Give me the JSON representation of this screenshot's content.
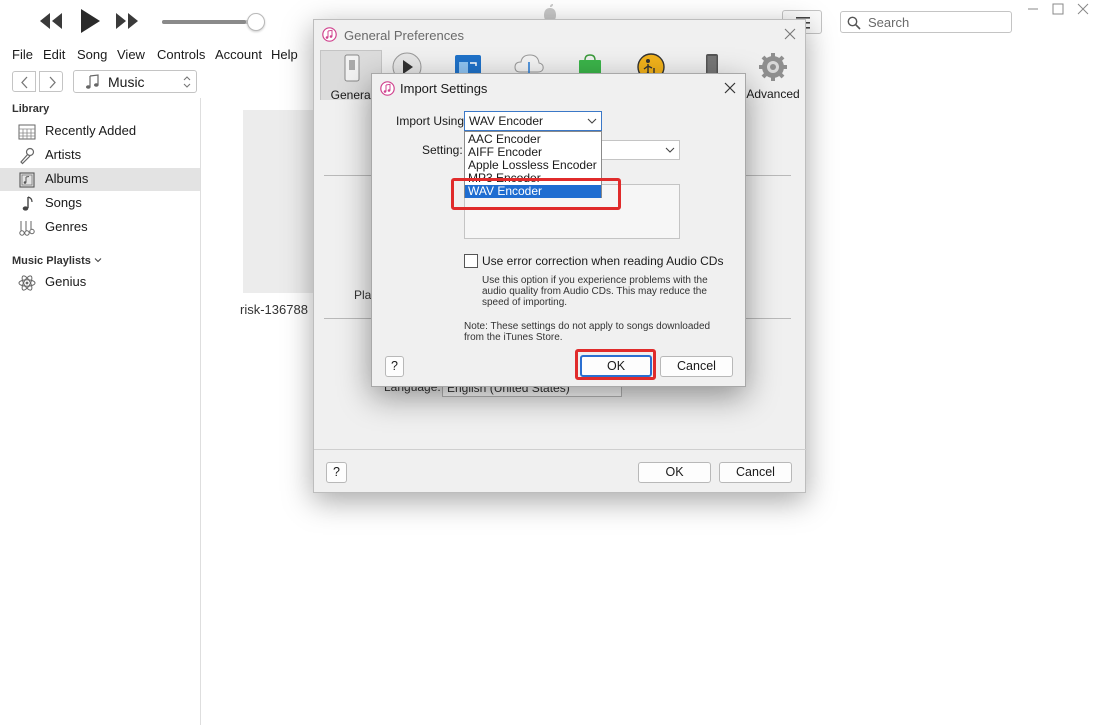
{
  "player": {
    "volume_fraction": 0.88
  },
  "search": {
    "placeholder": "Search"
  },
  "menu": [
    "File",
    "Edit",
    "Song",
    "View",
    "Controls",
    "Account",
    "Help"
  ],
  "media_select": {
    "value": "Music"
  },
  "sidebar": {
    "library_heading": "Library",
    "items": [
      {
        "label": "Recently Added",
        "icon": "calendar-grid-icon"
      },
      {
        "label": "Artists",
        "icon": "microphone-icon"
      },
      {
        "label": "Albums",
        "icon": "album-icon",
        "selected": true
      },
      {
        "label": "Songs",
        "icon": "music-note-icon"
      },
      {
        "label": "Genres",
        "icon": "genres-icon"
      }
    ],
    "playlists_heading": "Music Playlists",
    "playlists": [
      {
        "label": "Genius",
        "icon": "atom-icon"
      }
    ]
  },
  "main": {
    "album_title": "risk-136788"
  },
  "prefs": {
    "title": "General Preferences",
    "tabs": [
      {
        "label": "General",
        "icon": "switch-icon",
        "selected": true
      },
      {
        "label": "",
        "icon": "play-circle-icon"
      },
      {
        "label": "",
        "icon": "media-folder-icon"
      },
      {
        "label": "",
        "icon": "cloud-download-icon"
      },
      {
        "label": "",
        "icon": "store-bag-icon"
      },
      {
        "label": "",
        "icon": "parental-icon"
      },
      {
        "label": "",
        "icon": "device-icon"
      },
      {
        "label": "Advanced",
        "icon": "gear-icon"
      }
    ],
    "playback_fragment": "Play",
    "language_label_fragment": "Language:",
    "language_value": "English (United States)",
    "help_label": "?",
    "ok_label": "OK",
    "cancel_label": "Cancel"
  },
  "import": {
    "title": "Import Settings",
    "import_using_label": "Import Using:",
    "import_using_value": "WAV Encoder",
    "setting_label": "Setting:",
    "options": [
      "AAC Encoder",
      "AIFF Encoder",
      "Apple Lossless Encoder",
      "MP3 Encoder",
      "WAV Encoder"
    ],
    "selected_option": "WAV Encoder",
    "error_correction_label": "Use error correction when reading Audio CDs",
    "error_correction_checked": false,
    "error_correction_help": "Use this option if you experience problems with the audio quality from Audio CDs.  This may reduce the speed of importing.",
    "note": "Note: These settings do not apply to songs downloaded from the iTunes Store.",
    "help_label": "?",
    "ok_label": "OK",
    "cancel_label": "Cancel"
  },
  "colors": {
    "highlight": "#e02b2b",
    "selection": "#1f6dd1"
  }
}
